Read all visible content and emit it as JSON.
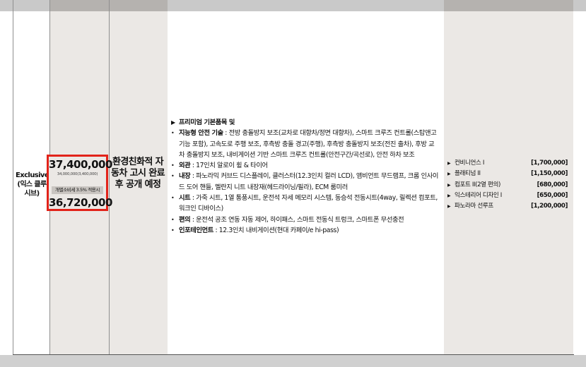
{
  "trim": {
    "name": "Exclusive (익스 클루시브)"
  },
  "price": {
    "base": "37,400,000",
    "base_detail": "34,000,000(3,400,000)",
    "tax_label": "개별소비세 3.5% 적용시",
    "tax_applied": "36,720,000"
  },
  "notice": "환경친화적 자동차 고시 완료 후 공개 예정",
  "features": [
    {
      "label": "프리미엄 기본품목 및",
      "text": ""
    },
    {
      "label": "지능형 안전 기술",
      "text": " : 전방 충돌방지 보조(교차로 대향차/정면 대향차), 스마트 크루즈 컨트롤(스탑앤고 기능 포함), 고속도로 주행 보조, 후측방 충돌 경고(주행), 후측방 충돌방지 보조(전진 출차), 후방 교차 충돌방지 보조, 내비게이션 기반 스마트 크루즈 컨트롤(안전구간/곡선로), 안전 하차 보조"
    },
    {
      "label": "외관",
      "text": " : 17인치 알로이 휠 & 타이어"
    },
    {
      "label": "내장",
      "text": " : 파노라믹 커브드 디스플레이, 클러스터(12.3인치 컬러 LCD), 앰비언트 무드램프, 크롬 인사이드 도어 핸들, 멜란지 니트 내장재(헤드라이닝/필라), ECM 룸미러"
    },
    {
      "label": "시트",
      "text": " : 가죽 시트, 1열 통풍시트, 운전석 자세 메모리 시스템, 동승석 전동시트(4way, 릴렉션 컴포트, 워크인 디바이스)"
    },
    {
      "label": "편의",
      "text": " : 운전석 공조 연동 자동 제어, 하이패스, 스마트 전동식 트렁크, 스마트폰 무선충전"
    },
    {
      "label": "인포테인먼트",
      "text": " : 12.3인치 내비게이션(현대 카페이/e hi-pass)"
    }
  ],
  "options": [
    {
      "name": "컨비니언스 I",
      "price": "[1,700,000]"
    },
    {
      "name": "플래티넘 II",
      "price": "[1,150,000]"
    },
    {
      "name": "컴포트 II(2열 편의)",
      "price": "[680,000]"
    },
    {
      "name": "익스테리어 디자인 I",
      "price": "[650,000]"
    },
    {
      "name": "파노라마 선루프",
      "price": "[1,200,000]"
    }
  ],
  "colors": {
    "highlight": "#e2231a",
    "column_bg": "#ebe8e5"
  }
}
